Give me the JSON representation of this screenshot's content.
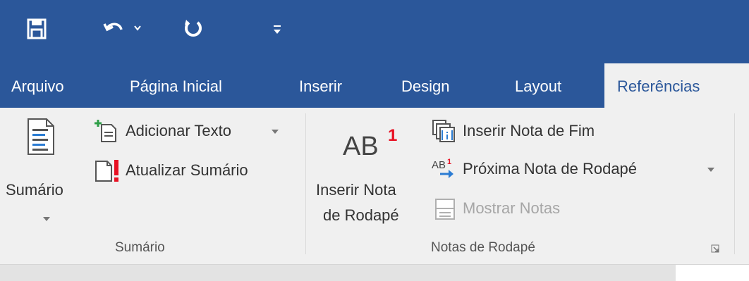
{
  "quick_access": {
    "save_icon": "save-icon",
    "undo_icon": "undo-icon",
    "repeat_icon": "repeat-icon",
    "customize_icon": "customize-qat-icon"
  },
  "tabs": [
    {
      "label": "Arquivo"
    },
    {
      "label": "Página Inicial"
    },
    {
      "label": "Inserir"
    },
    {
      "label": "Design"
    },
    {
      "label": "Layout"
    },
    {
      "label": "Referências"
    }
  ],
  "groups": {
    "sumario": {
      "label": "Sumário",
      "toc_button": {
        "line1": "Sumário"
      },
      "add_text": "Adicionar Texto",
      "update_toc": "Atualizar Sumário"
    },
    "notas": {
      "label": "Notas de Rodapé",
      "insert_footnote_big": "AB",
      "insert_footnote_sup": "1",
      "insert_footnote_line1": "Inserir Nota",
      "insert_footnote_line2": "de Rodapé",
      "insert_endnote": "Inserir Nota de Fim",
      "next_footnote": "Próxima Nota de Rodapé",
      "show_notes": "Mostrar Notas"
    }
  },
  "colors": {
    "title_bar": "#2b579a",
    "active_tab_text": "#2b579a",
    "ribbon_bg": "#f0f0f0",
    "accent_red": "#e81123",
    "accent_blue": "#2b7cd3"
  }
}
